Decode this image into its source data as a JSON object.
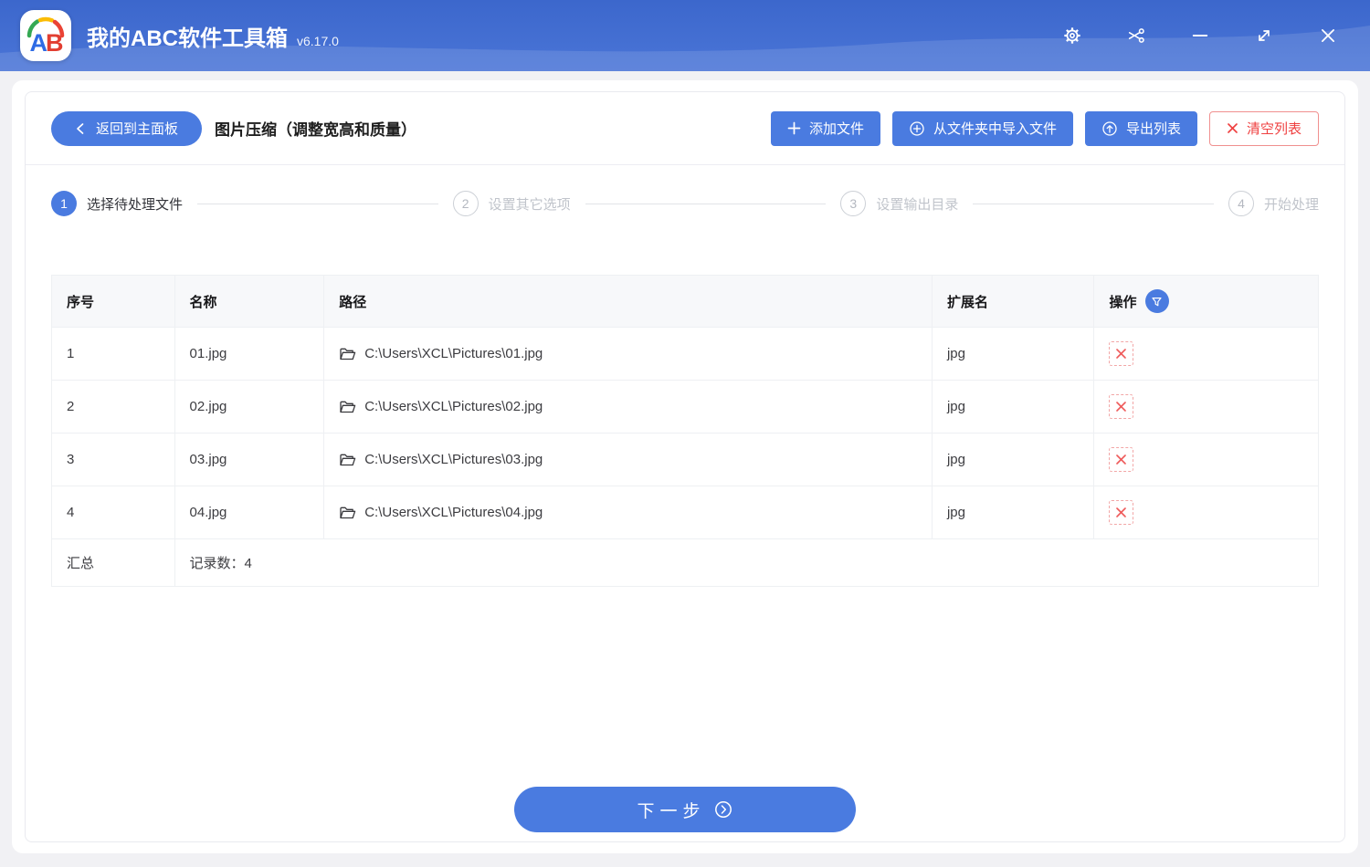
{
  "colors": {
    "accent": "#4a7be0",
    "danger": "#ef4040",
    "titlebar_top": "#3c67cc",
    "titlebar_bottom": "#5b85dd"
  },
  "titlebar": {
    "logo_a": "A",
    "logo_b": "B",
    "title": "我的ABC软件工具箱",
    "version": "v6.17.0",
    "window_icons": [
      "settings-icon",
      "scissors-icon",
      "minimize-icon",
      "resize-icon",
      "close-icon"
    ]
  },
  "header": {
    "back": "返回到主面板",
    "title": "图片压缩（调整宽高和质量）",
    "add_files": "添加文件",
    "import_folder": "从文件夹中导入文件",
    "export_list": "导出列表",
    "clear_list": "清空列表"
  },
  "steps": [
    {
      "num": "1",
      "label": "选择待处理文件"
    },
    {
      "num": "2",
      "label": "设置其它选项"
    },
    {
      "num": "3",
      "label": "设置输出目录"
    },
    {
      "num": "4",
      "label": "开始处理"
    }
  ],
  "table": {
    "headers": {
      "index": "序号",
      "name": "名称",
      "path": "路径",
      "ext": "扩展名",
      "action": "操作"
    },
    "rows": [
      {
        "index": "1",
        "name": "01.jpg",
        "path": "C:\\Users\\XCL\\Pictures\\01.jpg",
        "ext": "jpg"
      },
      {
        "index": "2",
        "name": "02.jpg",
        "path": "C:\\Users\\XCL\\Pictures\\02.jpg",
        "ext": "jpg"
      },
      {
        "index": "3",
        "name": "03.jpg",
        "path": "C:\\Users\\XCL\\Pictures\\03.jpg",
        "ext": "jpg"
      },
      {
        "index": "4",
        "name": "04.jpg",
        "path": "C:\\Users\\XCL\\Pictures\\04.jpg",
        "ext": "jpg"
      }
    ],
    "summary_label": "汇总",
    "summary_value": "记录数：4"
  },
  "footer": {
    "next": "下一步"
  }
}
